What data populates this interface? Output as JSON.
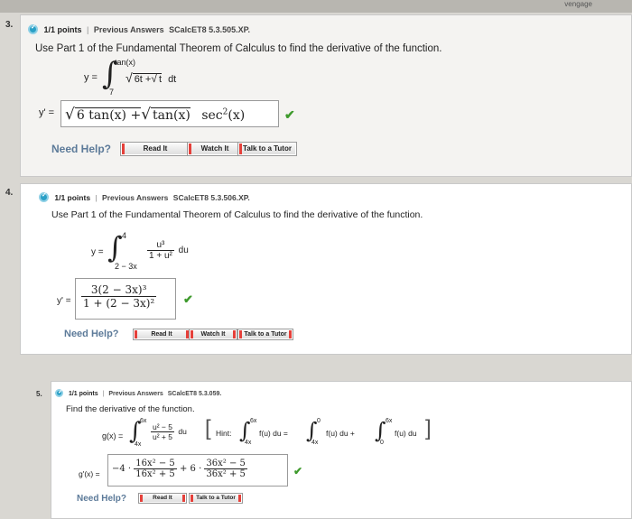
{
  "window": {
    "top_peek": "vengage"
  },
  "questions": [
    {
      "number": "3.",
      "points": "1/1 points",
      "sep": "|",
      "status": "Previous Answers",
      "code": "SCalcET8 5.3.505.XP.",
      "prompt": "Use Part 1 of the Fundamental Theorem of Calculus to find the derivative of the function.",
      "fn_lhs": "y =",
      "upper": "tan(x)",
      "lower": "7",
      "integrand_a": "6t +",
      "integrand_b": "t",
      "dt": "dt",
      "ans_lhs": "y' =",
      "ans_a": "6 tan(x) +",
      "ans_b": "tan(x)",
      "ans_c": "sec",
      "ans_sup": "2",
      "ans_d": "(x)",
      "help": "Need Help?",
      "buttons": [
        "Read It",
        "Watch It",
        "Talk to a Tutor"
      ]
    },
    {
      "number": "4.",
      "points": "1/1 points",
      "sep": "|",
      "status": "Previous Answers",
      "code": "SCalcET8 5.3.506.XP.",
      "prompt": "Use Part 1 of the Fundamental Theorem of Calculus to find the derivative of the function.",
      "fn_lhs": "y =",
      "upper": "4",
      "lower": "2 − 3x",
      "num": "u³",
      "den": "1 + u²",
      "du": "du",
      "ans_lhs": "y' =",
      "ans_num": "3(2 − 3x)³",
      "ans_den": "1 + (2 − 3x)²",
      "help": "Need Help?",
      "buttons": [
        "Read It",
        "Watch It",
        "Talk to a Tutor"
      ]
    },
    {
      "number": "5.",
      "points": "1/1 points",
      "sep": "|",
      "status": "Previous Answers",
      "code": "SCalcET8 5.3.059.",
      "prompt": "Find the derivative of the function.",
      "fn_lhs": "g(x) =",
      "upper": "6x",
      "lower": "4x",
      "num": "u² − 5",
      "den": "u² + 5",
      "du": "du",
      "hint_label": "Hint:",
      "hint_1": "f(u) du =",
      "hint_2": "f(u) du +",
      "hint_3": "f(u) du",
      "hint_upper_1": "6x",
      "hint_lower_1": "4x",
      "hint_upper_2": "0",
      "hint_lower_2": "4x",
      "hint_upper_3": "6x",
      "hint_lower_3": "0",
      "ans_lhs": "g'(x) =",
      "ans_coef1": "−4 ·",
      "ans_num1": "16x² − 5",
      "ans_den1": "16x² + 5",
      "ans_plus": "+ 6 ·",
      "ans_num2": "36x² − 5",
      "ans_den2": "36x² + 5",
      "help": "Need Help?",
      "buttons": [
        "Read It",
        "Talk to a Tutor"
      ]
    }
  ]
}
